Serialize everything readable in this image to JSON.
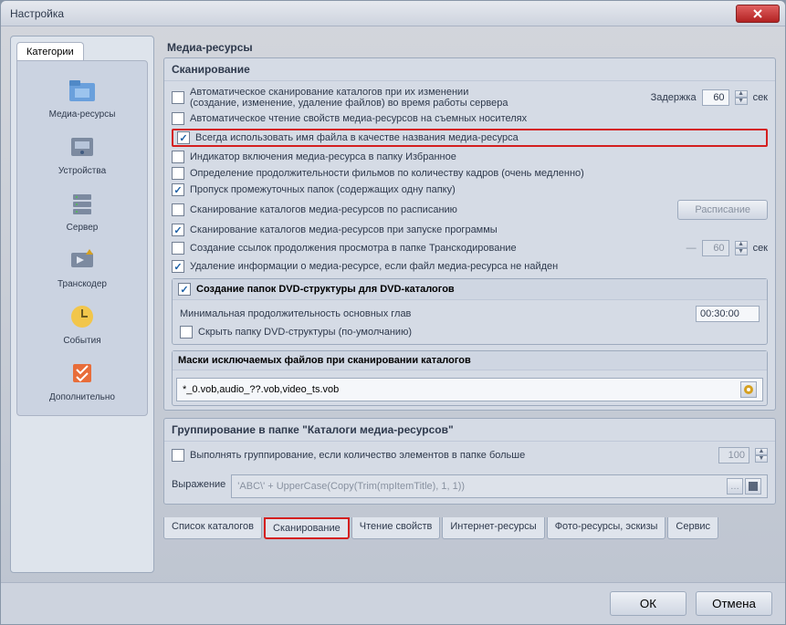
{
  "titlebar": {
    "title": "Настройка"
  },
  "sidebar": {
    "tab": "Категории",
    "items": [
      {
        "label": "Медиа-ресурсы"
      },
      {
        "label": "Устройства"
      },
      {
        "label": "Сервер"
      },
      {
        "label": "Транскодер"
      },
      {
        "label": "События"
      },
      {
        "label": "Дополнительно"
      }
    ]
  },
  "main": {
    "title": "Медиа-ресурсы",
    "scanning": {
      "title": "Сканирование",
      "auto_scan_label": "Автоматическое сканирование каталогов при их изменении (создание, изменение, удаление файлов) во время работы сервера",
      "delay_label": "Задержка",
      "delay_value": "60",
      "delay_unit": "сек",
      "auto_read_label": "Автоматическое чтение свойств медиа-ресурсов на съемных носителях",
      "use_filename_label": "Всегда использовать имя файла в качестве названия медиа-ресурса",
      "fav_indicator_label": "Индикатор включения медиа-ресурса в папку Избранное",
      "duration_by_frames_label": "Определение продолжительности фильмов по количеству кадров (очень медленно)",
      "skip_intermediate_label": "Пропуск промежуточных папок  (содержащих одну папку)",
      "schedule_scan_label": "Сканирование каталогов медиа-ресурсов по расписанию",
      "schedule_btn": "Расписание",
      "startup_scan_label": "Сканирование каталогов медиа-ресурсов при запуске программы",
      "create_links_label": "Создание ссылок продолжения просмотра в папке Транскодирование",
      "create_links_delay": "60",
      "create_links_unit": "сек",
      "remove_missing_label": "Удаление информации о медиа-ресурсе, если файл медиа-ресурса не найден",
      "dvd": {
        "title": "Создание папок DVD-структуры для DVD-каталогов",
        "min_duration_label": "Минимальная продолжительность основных глав",
        "min_duration_value": "00:30:00",
        "hide_dvd_label": "Скрыть папку DVD-структуры  (по-умолчанию)"
      },
      "masks": {
        "title": "Маски исключаемых файлов  при сканировании каталогов",
        "value": "*_0.vob,audio_??.vob,video_ts.vob"
      }
    },
    "grouping": {
      "title": "Группирование в папке \"Каталоги медиа-ресурсов\"",
      "enable_label": "Выполнять группирование, если количество элементов в папке больше",
      "threshold": "100",
      "expr_label": "Выражение",
      "expr_value": "'ABC\\' + UpperCase(Copy(Trim(mpItemTitle), 1, 1))"
    },
    "tabs": [
      "Список каталогов",
      "Сканирование",
      "Чтение свойств",
      "Интернет-ресурсы",
      "Фото-ресурсы, эскизы",
      "Сервис"
    ]
  },
  "footer": {
    "ok": "ОК",
    "cancel": "Отмена"
  }
}
